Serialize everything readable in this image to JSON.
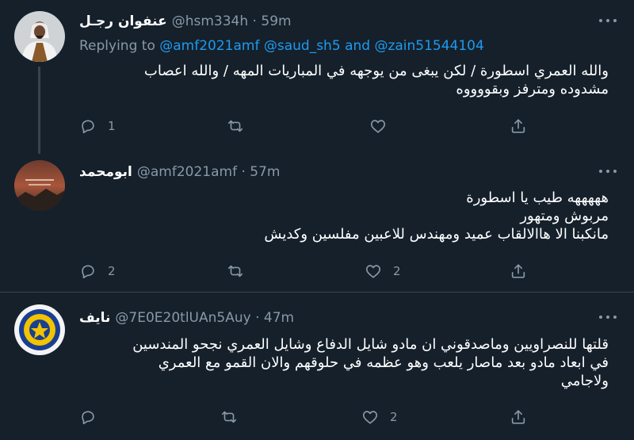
{
  "tweets": [
    {
      "name": "عنفوان رجـل",
      "handle": "@hsm334h",
      "time": "59m",
      "replying_prefix": "Replying to",
      "replying_to_1": "@amf2021amf",
      "replying_to_2": "@saud_sh5",
      "replying_and": "and",
      "replying_to_3": "@zain51544104",
      "lines": [
        "والله العمري اسطورة  / لكن يبغى من يوجهه في المباريات المهه / والله اعصاب",
        "مشدوده ومترفز وبقووووه"
      ],
      "reply_count": "1",
      "retweet_count": "",
      "like_count": ""
    },
    {
      "name": "ابومحمد",
      "handle": "@amf2021amf",
      "time": "57m",
      "lines": [
        "هههههه طيب يا اسطورة",
        "مربوش ومتهور",
        "مانكبنا الا هاالالقاب عميد ومهندس للاعبين مفلسين وكديش"
      ],
      "reply_count": "2",
      "retweet_count": "",
      "like_count": "2"
    },
    {
      "name": "نايف",
      "handle": "@7E0E20tlUAn5Auy",
      "time": "47m",
      "lines": [
        "قلتها للنصراويين وماصدقوني ان مادو شايل الدفاع وشايل العمري  نجحو المندسين",
        "في ابعاد مادو بعد ماصار يلعب وهو عظمه في حلوقهم  والان القمو مع العمري",
        "ولاجامي"
      ],
      "reply_count": "",
      "retweet_count": "",
      "like_count": "2"
    }
  ],
  "icons": {
    "reply": "reply-icon",
    "retweet": "retweet-icon",
    "like": "like-icon",
    "share": "share-icon",
    "more": "more-icon"
  },
  "colors": {
    "background": "#15202b",
    "text": "#e7e9ea",
    "muted": "#8899a6",
    "link": "#1d9bf0",
    "separator": "#38444d"
  }
}
